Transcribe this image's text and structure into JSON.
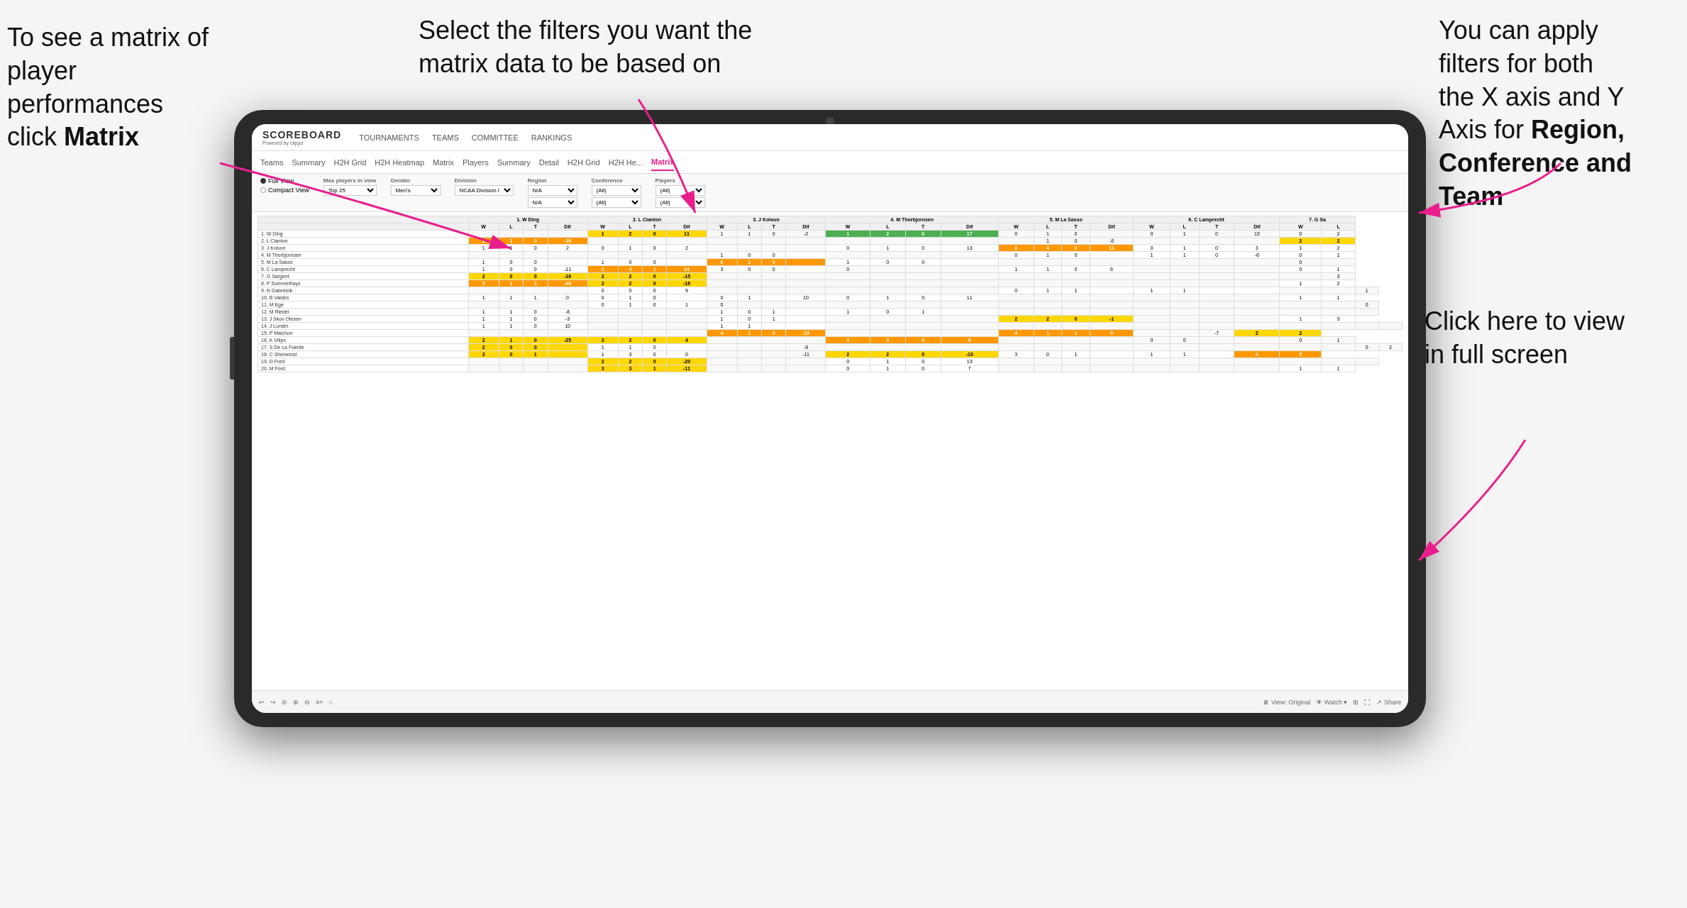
{
  "annotations": {
    "top_left": {
      "line1": "To see a matrix of",
      "line2": "player performances",
      "line3_normal": "click ",
      "line3_bold": "Matrix"
    },
    "top_center": {
      "text": "Select the filters you want the matrix data to be based on"
    },
    "top_right": {
      "line1": "You  can apply",
      "line2": "filters for both",
      "line3": "the X axis and Y",
      "line4_normal": "Axis for ",
      "line4_bold": "Region,",
      "line5_bold": "Conference and",
      "line6_bold": "Team"
    },
    "bottom_right": {
      "line1": "Click here to view",
      "line2": "in full screen"
    }
  },
  "app": {
    "logo": {
      "title": "SCOREBOARD",
      "subtitle": "Powered by clippd"
    },
    "nav": {
      "items": [
        "TOURNAMENTS",
        "TEAMS",
        "COMMITTEE",
        "RANKINGS"
      ]
    },
    "sub_nav": {
      "items": [
        "Teams",
        "Summary",
        "H2H Grid",
        "H2H Heatmap",
        "Matrix",
        "Players",
        "Summary",
        "Detail",
        "H2H Grid",
        "H2H He...",
        "Matrix"
      ]
    },
    "filters": {
      "view_options": [
        "Full View",
        "Compact View"
      ],
      "selected_view": "Full View",
      "max_players_label": "Max players in view",
      "max_players_value": "Top 25",
      "gender_label": "Gender",
      "gender_value": "Men's",
      "division_label": "Division",
      "division_value": "NCAA Division I",
      "region_label": "Region",
      "region_values": [
        "N/A",
        "N/A"
      ],
      "conference_label": "Conference",
      "conference_values": [
        "(All)",
        "(All)"
      ],
      "players_label": "Players",
      "players_values": [
        "(All)",
        "(All)"
      ]
    },
    "matrix": {
      "col_headers": [
        "1. W Ding",
        "2. L Clanton",
        "3. J Koivun",
        "4. M Thorbjornsen",
        "5. M La Sasso",
        "6. C Lamprecht",
        "7. G Sa"
      ],
      "sub_headers": [
        "W",
        "L",
        "T",
        "Dif"
      ],
      "rows": [
        {
          "name": "1. W Ding",
          "cells": [
            [
              "",
              "",
              "",
              ""
            ],
            [
              "1",
              "2",
              "0",
              "11"
            ],
            [
              "1",
              "1",
              "0",
              "-2"
            ],
            [
              "1",
              "2",
              "0",
              "17"
            ],
            [
              "0",
              "1",
              "0",
              ""
            ],
            [
              "0",
              "1",
              "0",
              "13"
            ],
            [
              "0",
              "2"
            ]
          ]
        },
        {
          "name": "2. L Clanton",
          "cells": [
            [
              "2",
              "1",
              "0",
              "-16"
            ],
            [
              "",
              "",
              "",
              ""
            ],
            [
              "",
              "",
              "",
              ""
            ],
            [
              "",
              "",
              "",
              ""
            ],
            [
              "",
              "1",
              "0",
              "-6"
            ],
            [
              "",
              "",
              "",
              ""
            ],
            [
              "2",
              "2"
            ]
          ]
        },
        {
          "name": "3. J Koivun",
          "cells": [
            [
              "1",
              "1",
              "0",
              "2"
            ],
            [
              "0",
              "1",
              "0",
              "2"
            ],
            [
              "",
              "",
              "",
              ""
            ],
            [
              "0",
              "1",
              "0",
              "13"
            ],
            [
              "0",
              "4",
              "0",
              "11"
            ],
            [
              "0",
              "1",
              "0",
              "3"
            ],
            [
              "1",
              "2"
            ]
          ]
        },
        {
          "name": "4. M Thorbjornsen",
          "cells": [
            [
              "",
              "",
              "",
              ""
            ],
            [
              "",
              "",
              "",
              ""
            ],
            [
              "1",
              "0",
              "0",
              ""
            ],
            [
              "",
              "",
              "",
              ""
            ],
            [
              "0",
              "1",
              "0",
              ""
            ],
            [
              "1",
              "1",
              "0",
              "-6"
            ],
            [
              "0",
              "1"
            ]
          ]
        },
        {
          "name": "5. M La Sasso",
          "cells": [
            [
              "1",
              "0",
              "0",
              ""
            ],
            [
              "1",
              "0",
              "0",
              ""
            ],
            [
              "6",
              "1",
              "0",
              ""
            ],
            [
              "1",
              "0",
              "0",
              ""
            ],
            [
              "",
              "",
              "",
              ""
            ],
            [
              "",
              "",
              "",
              ""
            ],
            [
              "0",
              ""
            ]
          ]
        },
        {
          "name": "6. C Lamprecht",
          "cells": [
            [
              "1",
              "0",
              "0",
              "-11"
            ],
            [
              "2",
              "4",
              "1",
              "24"
            ],
            [
              "3",
              "0",
              "0",
              ""
            ],
            [
              "0",
              "",
              "",
              ""
            ],
            [
              "1",
              "1",
              "0",
              "6"
            ],
            [
              "",
              "",
              "",
              ""
            ],
            [
              "0",
              "1"
            ]
          ]
        },
        {
          "name": "7. G Sargent",
          "cells": [
            [
              "2",
              "0",
              "0",
              "-16"
            ],
            [
              "2",
              "2",
              "0",
              "-15"
            ],
            [
              "",
              "",
              "",
              ""
            ],
            [
              "",
              "",
              "",
              ""
            ],
            [
              "",
              "",
              "",
              ""
            ],
            [
              "",
              "",
              "",
              ""
            ],
            [
              "",
              "3"
            ]
          ]
        },
        {
          "name": "8. P Summerhays",
          "cells": [
            [
              "5",
              "1",
              "2",
              "-48"
            ],
            [
              "2",
              "2",
              "0",
              "-16"
            ],
            [
              "",
              "",
              "",
              ""
            ],
            [
              "",
              "",
              "",
              ""
            ],
            [
              "",
              "",
              "",
              ""
            ],
            [
              "",
              "",
              "",
              ""
            ],
            [
              "1",
              "2"
            ]
          ]
        },
        {
          "name": "9. N Gabrelcik",
          "cells": [
            [
              "",
              "",
              "",
              ""
            ],
            [
              "0",
              "0",
              "0",
              "9"
            ],
            [
              "",
              "",
              "",
              ""
            ],
            [
              "",
              "",
              "",
              ""
            ],
            [
              "0",
              "1",
              "1",
              ""
            ],
            [
              "1",
              "1",
              "",
              ""
            ],
            [
              "",
              "",
              "1"
            ]
          ]
        },
        {
          "name": "10. B Valdes",
          "cells": [
            [
              "1",
              "1",
              "1",
              "0"
            ],
            [
              "0",
              "1",
              "0",
              ""
            ],
            [
              "0",
              "1",
              "",
              "10"
            ],
            [
              "0",
              "1",
              "0",
              "11"
            ],
            [
              "",
              "",
              "",
              ""
            ],
            [
              "",
              "",
              "",
              ""
            ],
            [
              "1",
              "1"
            ]
          ]
        },
        {
          "name": "11. M Ege",
          "cells": [
            [
              "",
              "",
              "",
              ""
            ],
            [
              "0",
              "1",
              "0",
              "1"
            ],
            [
              "0",
              "",
              "",
              ""
            ],
            [
              "",
              "",
              "",
              ""
            ],
            [
              "",
              "",
              "",
              ""
            ],
            [
              "",
              "",
              "",
              ""
            ],
            [
              "",
              "",
              "0"
            ]
          ]
        },
        {
          "name": "12. M Riedel",
          "cells": [
            [
              "1",
              "1",
              "0",
              "-6"
            ],
            [
              "",
              "",
              "",
              ""
            ],
            [
              "1",
              "0",
              "1",
              ""
            ],
            [
              "1",
              "0",
              "1",
              ""
            ],
            [
              "",
              "",
              "",
              ""
            ],
            [
              "",
              "",
              "",
              ""
            ],
            [
              "",
              "",
              ""
            ]
          ]
        },
        {
          "name": "13. J Skov Olesen",
          "cells": [
            [
              "1",
              "1",
              "0",
              "-3"
            ],
            [
              "",
              "",
              "",
              ""
            ],
            [
              "1",
              "0",
              "1",
              ""
            ],
            [
              "",
              "",
              "",
              ""
            ],
            [
              "2",
              "2",
              "0",
              "-1"
            ],
            [
              "",
              "",
              "",
              ""
            ],
            [
              "1",
              "3"
            ]
          ]
        },
        {
          "name": "14. J Lundin",
          "cells": [
            [
              "1",
              "1",
              "0",
              "10"
            ],
            [
              "",
              "",
              "",
              ""
            ],
            [
              "1",
              "1",
              "",
              ""
            ],
            [
              "",
              "",
              "",
              ""
            ],
            [
              "",
              "",
              "",
              ""
            ],
            [
              "",
              "",
              "",
              ""
            ],
            [
              "",
              "",
              "",
              ""
            ]
          ]
        },
        {
          "name": "15. P Maichon",
          "cells": [
            [
              "",
              "",
              "",
              ""
            ],
            [
              "",
              "",
              "",
              ""
            ],
            [
              "4",
              "1",
              "0",
              "-19"
            ],
            [
              "",
              "",
              "",
              ""
            ],
            [
              "4",
              "1",
              "1",
              "0"
            ],
            [
              "",
              "",
              "-7"
            ],
            [
              "2",
              "2"
            ]
          ]
        },
        {
          "name": "16. K Vilips",
          "cells": [
            [
              "2",
              "1",
              "0",
              "-25"
            ],
            [
              "2",
              "2",
              "0",
              "4"
            ],
            [
              "",
              "",
              "",
              ""
            ],
            [
              "3",
              "3",
              "0",
              "8"
            ],
            [
              "",
              "",
              "",
              ""
            ],
            [
              "0",
              "0",
              ""
            ],
            [
              "",
              "0",
              "1"
            ]
          ]
        },
        {
          "name": "17. S De La Fuente",
          "cells": [
            [
              "2",
              "0",
              "0",
              ""
            ],
            [
              "1",
              "1",
              "0",
              ""
            ],
            [
              "",
              "",
              "",
              "-8"
            ],
            [
              "",
              "",
              "",
              ""
            ],
            [
              "",
              "",
              "",
              ""
            ],
            [
              "",
              "",
              "",
              ""
            ],
            [
              "",
              "",
              "0",
              "2"
            ]
          ]
        },
        {
          "name": "18. C Sherwood",
          "cells": [
            [
              "2",
              "0",
              "1",
              ""
            ],
            [
              "1",
              "3",
              "0",
              "0"
            ],
            [
              "",
              "",
              "",
              "-11"
            ],
            [
              "2",
              "2",
              "0",
              "-10"
            ],
            [
              "3",
              "0",
              "1",
              ""
            ],
            [
              "1",
              "1",
              ""
            ],
            [
              "4",
              "5"
            ]
          ]
        },
        {
          "name": "19. D Ford",
          "cells": [
            [
              "",
              "",
              "",
              ""
            ],
            [
              "2",
              "2",
              "0",
              "-20"
            ],
            [
              "",
              "",
              "",
              ""
            ],
            [
              "0",
              "1",
              "0",
              "13"
            ],
            [
              "",
              "",
              "",
              ""
            ],
            [
              "",
              "",
              "",
              ""
            ],
            [
              "",
              "",
              ""
            ]
          ]
        },
        {
          "name": "20. M Ford",
          "cells": [
            [
              "",
              "",
              "",
              ""
            ],
            [
              "3",
              "3",
              "1",
              "-11"
            ],
            [
              "",
              "",
              "",
              ""
            ],
            [
              "0",
              "1",
              "0",
              "7"
            ],
            [
              "",
              "",
              "",
              ""
            ],
            [
              "",
              "",
              "",
              ""
            ],
            [
              "1",
              "1"
            ]
          ]
        }
      ]
    },
    "toolbar": {
      "left_icons": [
        "↩",
        "↪",
        "⊘",
        "⊕",
        "⊖",
        "≡+",
        "○"
      ],
      "view_original": "View: Original",
      "watch": "Watch ▾",
      "share": "Share"
    }
  }
}
